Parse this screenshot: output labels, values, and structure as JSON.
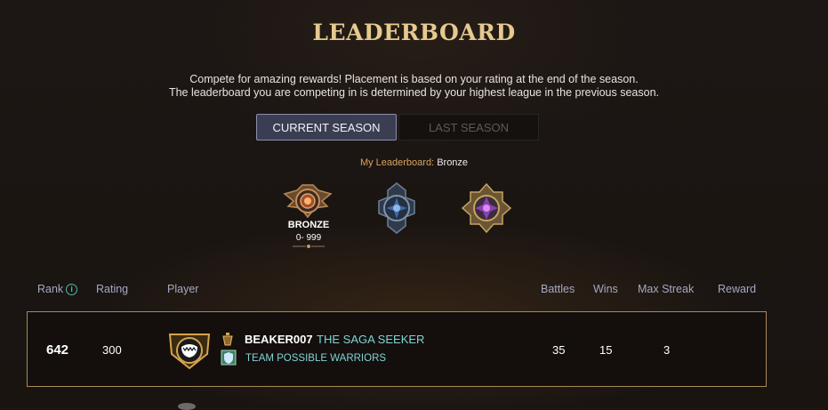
{
  "title": "LEADERBOARD",
  "description": {
    "line1": "Compete for amazing rewards! Placement is based on your rating at the end of the season.",
    "line2": "The leaderboard you are competing in is determined by your highest league in the previous season."
  },
  "tabs": [
    {
      "label": "CURRENT SEASON",
      "active": true
    },
    {
      "label": "LAST SEASON",
      "active": false
    }
  ],
  "my_leaderboard": {
    "label": "My Leaderboard:",
    "value": "Bronze"
  },
  "leagues": [
    {
      "icon": "bronze-league-icon",
      "name": "BRONZE",
      "range": "0- 999",
      "selected": true
    },
    {
      "icon": "silver-league-icon",
      "selected": false
    },
    {
      "icon": "gold-league-icon",
      "selected": false
    }
  ],
  "columns": {
    "rank": "Rank",
    "rating": "Rating",
    "player": "Player",
    "battles": "Battles",
    "wins": "Wins",
    "max_streak": "Max Streak",
    "reward": "Reward"
  },
  "rows": [
    {
      "rank": "642",
      "rating": "300",
      "player": "BEAKER007",
      "player_title": "THE SAGA SEEKER",
      "guild": "TEAM POSSIBLE WARRIORS",
      "battles": "35",
      "wins": "15",
      "max_streak": "3",
      "reward": ""
    }
  ],
  "colors": {
    "accent_gold": "#e5c98f",
    "tab_active_bg": "#3b3e53",
    "row_border": "#a78a55",
    "teal_text": "#7fd3d7"
  }
}
